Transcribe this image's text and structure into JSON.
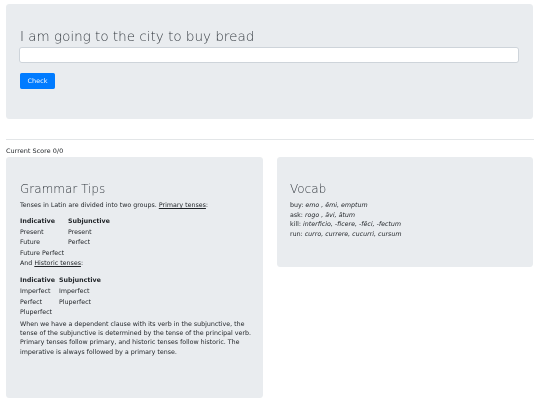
{
  "prompt": {
    "sentence": "I am going to the city to buy bread",
    "answer_value": "",
    "check_label": "Check"
  },
  "score": {
    "text": "Current Score 0/0"
  },
  "grammar": {
    "title": "Grammar Tips",
    "intro_text": "Tenses in Latin are divided into two groups.",
    "primary_link": "Primary tenses",
    "intro_colon": ":",
    "primary_table": {
      "headers": [
        "Indicative",
        "Subjunctive"
      ],
      "rows": [
        [
          "Present",
          "Present"
        ],
        [
          "Future",
          "Perfect"
        ],
        [
          "Future Perfect",
          ""
        ]
      ]
    },
    "and_text": "And",
    "historic_link": "Historic tenses",
    "historic_colon": ":",
    "historic_table": {
      "headers": [
        "Indicative",
        "Subjunctive"
      ],
      "rows": [
        [
          "Imperfect",
          "Imperfect"
        ],
        [
          "Perfect",
          "Pluperfect"
        ],
        [
          "Pluperfect",
          ""
        ]
      ]
    },
    "explanation": "When we have a dependent clause with its verb in the subjunctive, the tense of the subjunctive is determined by the tense of the principal verb. Primary tenses follow primary, and historic tenses follow historic. The imperative is always followed by a primary tense."
  },
  "vocab": {
    "title": "Vocab",
    "entries": [
      {
        "english": "buy:",
        "latin": "emo , ēmi, emptum"
      },
      {
        "english": "ask:",
        "latin": "rogo , āvi, ātum"
      },
      {
        "english": "kill:",
        "latin": "interficio, -ficere, -fēci, -fectum"
      },
      {
        "english": "run:",
        "latin": "curro, currere, cucurri, cursum"
      }
    ]
  }
}
